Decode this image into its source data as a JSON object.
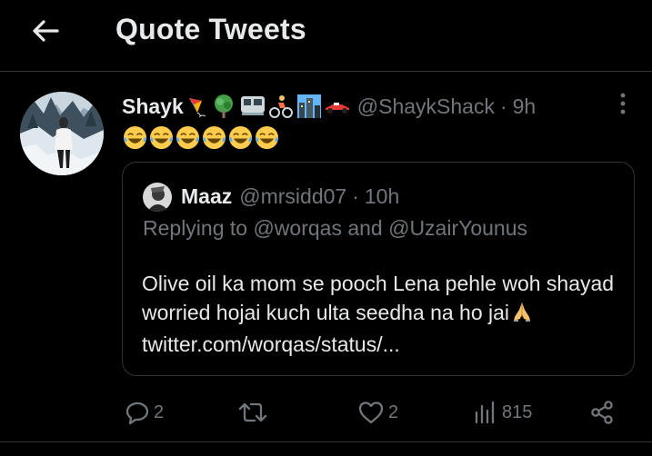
{
  "header": {
    "title": "Quote Tweets"
  },
  "tweet": {
    "display_name": "Shayk",
    "handle": "@ShaykShack",
    "separator": "·",
    "time": "9h",
    "text_emojis": [
      "😂",
      "😂",
      "😂",
      "😂",
      "😂",
      "😂"
    ]
  },
  "quoted_tweet": {
    "display_name": "Maaz",
    "handle": "@mrsidd07",
    "separator": "·",
    "time": "10h",
    "replying_to": "Replying to @worqas and @UzairYounus",
    "text_before_emoji": "Olive oil ka mom se pooch Lena pehle woh shayad worried hojai kuch ulta seedha na ho jai",
    "link": "twitter.com/worqas/status/..."
  },
  "actions": {
    "reply_count": "2",
    "retweet_count": "",
    "like_count": "2",
    "views_count": "815"
  },
  "colors": {
    "background": "#000000",
    "text_primary": "#e7e9ea",
    "text_secondary": "#71767b",
    "border": "#2f3336"
  },
  "icons": [
    "back-arrow-icon",
    "more-icon",
    "reply-icon",
    "retweet-icon",
    "like-icon",
    "views-icon",
    "share-icon"
  ]
}
